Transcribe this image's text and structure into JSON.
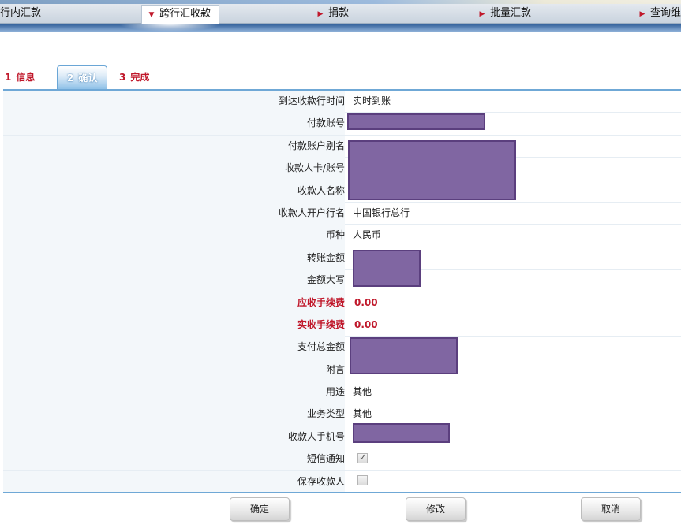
{
  "nav": {
    "items": [
      {
        "label": "行内汇款",
        "arrow": ""
      },
      {
        "label": "跨行汇收款",
        "arrow": "▼",
        "active": true
      },
      {
        "label": "捐款",
        "arrow": "▶"
      },
      {
        "label": "批量汇款",
        "arrow": "▶"
      },
      {
        "label": "查询维",
        "arrow": "▶"
      }
    ]
  },
  "steps": [
    {
      "num": "1",
      "label": "信息"
    },
    {
      "num": "2",
      "label": "确认",
      "active": true
    },
    {
      "num": "3",
      "label": "完成"
    }
  ],
  "form": {
    "arrival_time_label": "到达收款行时间",
    "arrival_time_value": "实时到账",
    "payer_account_label": "付款账号",
    "payer_alias_label": "付款账户别名",
    "payee_card_label": "收款人卡/账号",
    "payee_name_label": "收款人名称",
    "payee_bank_label": "收款人开户行名",
    "payee_bank_value": "中国银行总行",
    "currency_label": "币种",
    "currency_value": "人民币",
    "amount_label": "转账金额",
    "amount_words_label": "金额大写",
    "fee_due_label": "应收手续费",
    "fee_due_value": "0.00",
    "fee_actual_label": "实收手续费",
    "fee_actual_value": "0.00",
    "total_label": "支付总金额",
    "note_label": "附言",
    "purpose_label": "用途",
    "purpose_value": "其他",
    "business_type_label": "业务类型",
    "business_type_value": "其他",
    "payee_phone_label": "收款人手机号",
    "sms_notify_label": "短信通知",
    "sms_notify_checked": true,
    "save_payee_label": "保存收款人",
    "save_payee_checked": false
  },
  "buttons": {
    "confirm": "确定",
    "modify": "修改",
    "cancel": "取消"
  },
  "colors": {
    "accent_red": "#c0182b",
    "redaction": "#8066a2",
    "step_blue": "#6aa6d6"
  }
}
